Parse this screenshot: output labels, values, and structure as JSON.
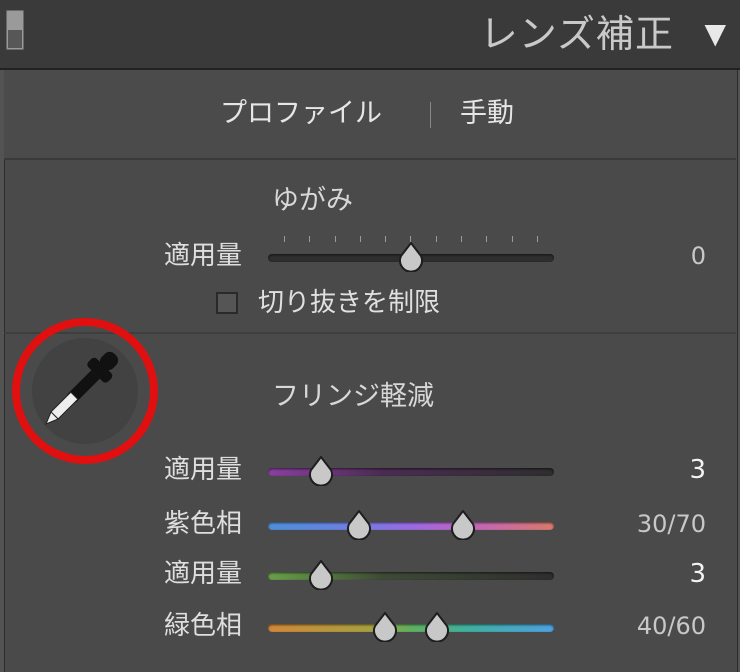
{
  "header": {
    "title": "レンズ補正",
    "arrow_icon": "triangle-down-icon"
  },
  "tabs": [
    {
      "label": "プロファイル"
    },
    {
      "label": "手動"
    }
  ],
  "distortion": {
    "title": "ゆがみ",
    "amount": {
      "label": "適用量",
      "value": "0",
      "position": 0.5
    },
    "constrain_crop": {
      "label": "切り抜きを制限",
      "checked": false
    }
  },
  "defringe": {
    "title": "フリンジ軽減",
    "eyedropper_icon": "eyedropper-icon",
    "purple_amount": {
      "label": "適用量",
      "value": "3",
      "position": 0.15
    },
    "purple_hue": {
      "label": "紫色相",
      "value": "30/70",
      "low": 0.3,
      "high": 0.7
    },
    "green_amount": {
      "label": "適用量",
      "value": "3",
      "position": 0.15
    },
    "green_hue": {
      "label": "緑色相",
      "value": "40/60",
      "low": 0.4,
      "high": 0.6
    }
  },
  "colors": {
    "highlight_circle": "#e01010",
    "purple_track": [
      "#6a4a78",
      "#7a3a88"
    ],
    "green_track": [
      "#4a6a3a",
      "#5a7a3a"
    ]
  }
}
